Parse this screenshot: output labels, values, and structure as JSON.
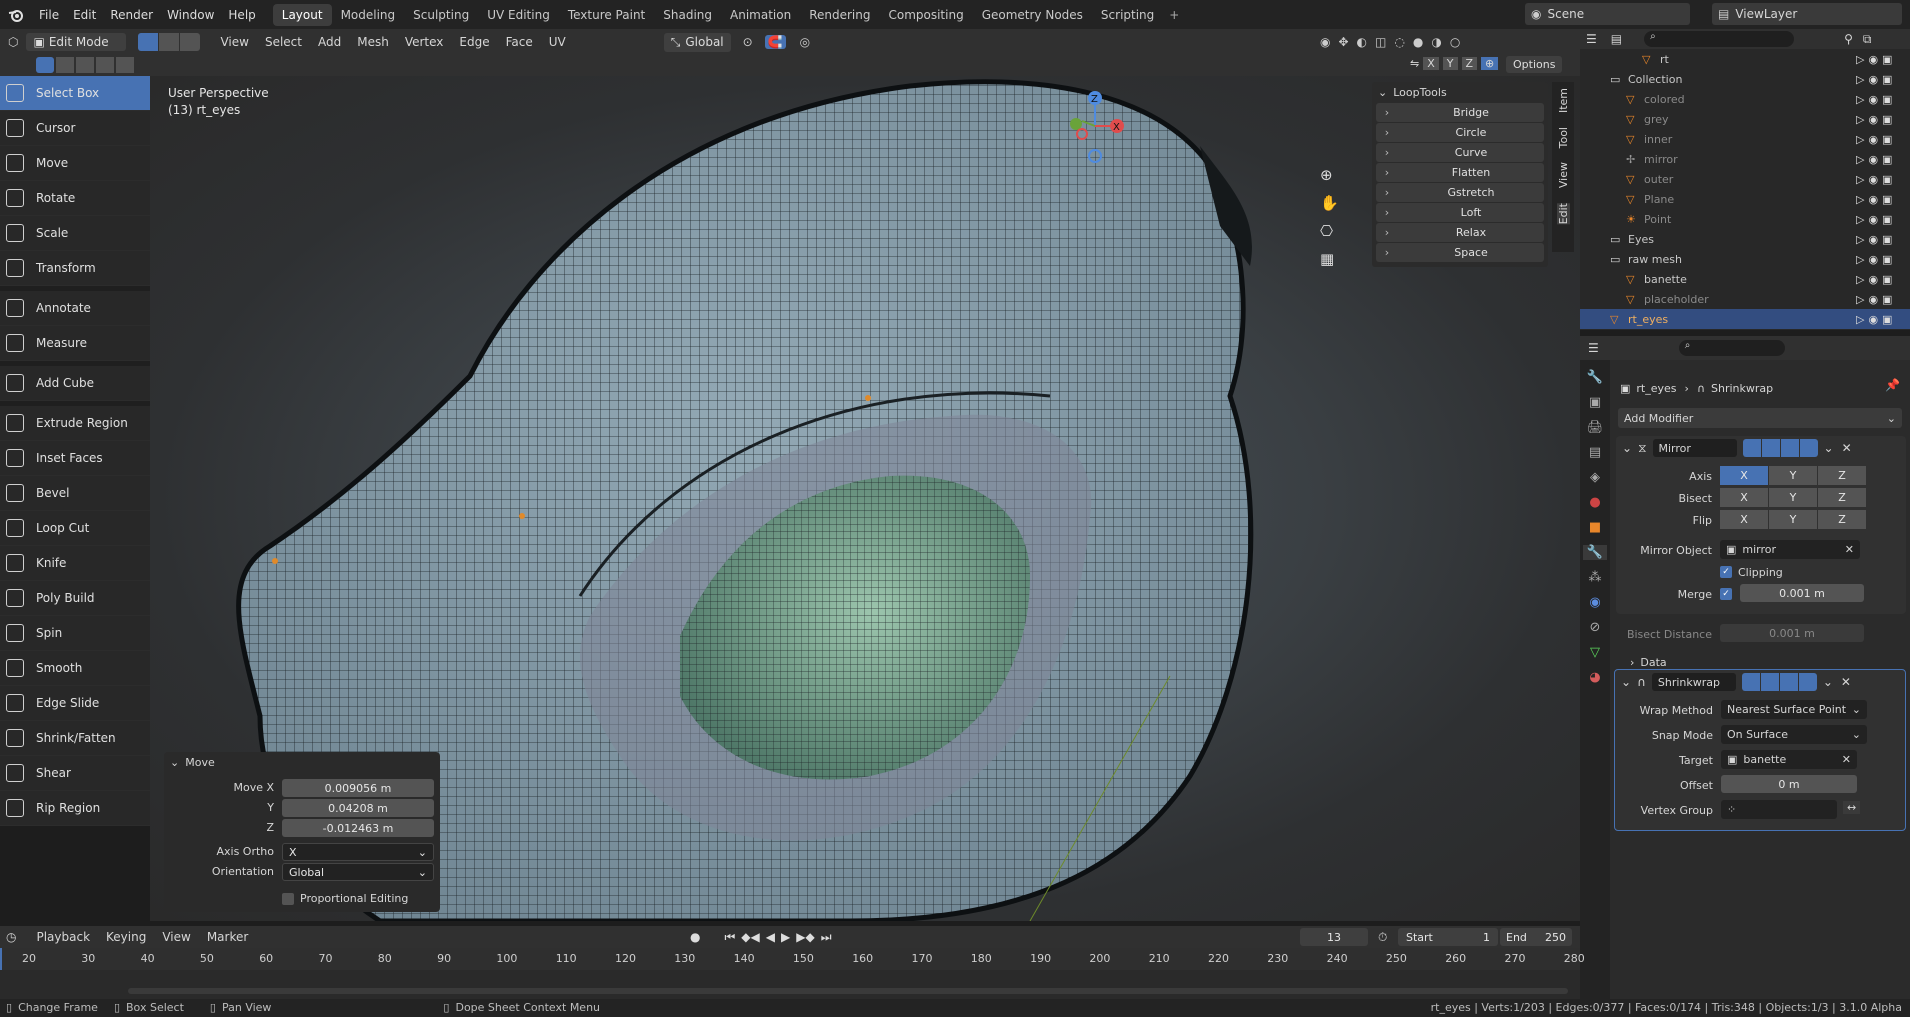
{
  "menu": [
    "File",
    "Edit",
    "Render",
    "Window",
    "Help"
  ],
  "workspaces": [
    "Layout",
    "Modeling",
    "Sculpting",
    "UV Editing",
    "Texture Paint",
    "Shading",
    "Animation",
    "Rendering",
    "Compositing",
    "Geometry Nodes",
    "Scripting"
  ],
  "scene": "Scene",
  "view_layer": "ViewLayer",
  "header": {
    "mode": "Edit Mode",
    "menus": [
      "View",
      "Select",
      "Add",
      "Mesh",
      "Vertex",
      "Edge",
      "Face",
      "UV"
    ],
    "transform_orientation": "Global",
    "axes": [
      "X",
      "Y",
      "Z"
    ],
    "options": "Options"
  },
  "tools": [
    "Select Box",
    "Cursor",
    "Move",
    "Rotate",
    "Scale",
    "Transform",
    "Annotate",
    "Measure",
    "Add Cube",
    "Extrude Region",
    "Inset Faces",
    "Bevel",
    "Loop Cut",
    "Knife",
    "Poly Build",
    "Spin",
    "Smooth",
    "Edge Slide",
    "Shrink/Fatten",
    "Shear",
    "Rip Region"
  ],
  "viewport": {
    "perspective": "User Perspective",
    "object": "(13) rt_eyes"
  },
  "looptools": {
    "title": "LoopTools",
    "items": [
      "Bridge",
      "Circle",
      "Curve",
      "Flatten",
      "Gstretch",
      "Loft",
      "Relax",
      "Space"
    ]
  },
  "side_tabs": [
    "Item",
    "Tool",
    "View",
    "Edit"
  ],
  "move_panel": {
    "title": "Move",
    "move_x_label": "Move X",
    "move_x": "0.009056 m",
    "y_label": "Y",
    "y": "0.04208 m",
    "z_label": "Z",
    "z": "-0.012463 m",
    "axis_ortho_label": "Axis Ortho",
    "axis_ortho": "X",
    "orientation_label": "Orientation",
    "orientation": "Global",
    "proportional": "Proportional Editing"
  },
  "outliner": [
    {
      "name": "rt",
      "indent": 3,
      "type": "mesh"
    },
    {
      "name": "Collection",
      "indent": 1,
      "type": "collection"
    },
    {
      "name": "colored",
      "indent": 2,
      "type": "mesh",
      "dim": true
    },
    {
      "name": "grey",
      "indent": 2,
      "type": "mesh",
      "dim": true
    },
    {
      "name": "inner",
      "indent": 2,
      "type": "mesh",
      "dim": true
    },
    {
      "name": "mirror",
      "indent": 2,
      "type": "empty",
      "dim": true
    },
    {
      "name": "outer",
      "indent": 2,
      "type": "mesh",
      "dim": true
    },
    {
      "name": "Plane",
      "indent": 2,
      "type": "mesh",
      "dim": true
    },
    {
      "name": "Point",
      "indent": 2,
      "type": "light",
      "dim": true
    },
    {
      "name": "Eyes",
      "indent": 1,
      "type": "collection"
    },
    {
      "name": "raw mesh",
      "indent": 1,
      "type": "collection"
    },
    {
      "name": "banette",
      "indent": 2,
      "type": "mesh"
    },
    {
      "name": "placeholder",
      "indent": 2,
      "type": "mesh",
      "dim": true
    },
    {
      "name": "rt_eyes",
      "indent": 1,
      "type": "mesh",
      "highlight": true
    }
  ],
  "properties": {
    "breadcrumb_object": "rt_eyes",
    "breadcrumb_modifier": "Shrinkwrap",
    "add_modifier": "Add Modifier",
    "mirror": {
      "name": "Mirror",
      "axis_label": "Axis",
      "bisect_label": "Bisect",
      "flip_label": "Flip",
      "axes": [
        "X",
        "Y",
        "Z"
      ],
      "mirror_object_label": "Mirror Object",
      "mirror_object": "mirror",
      "clipping": "Clipping",
      "merge_label": "Merge",
      "merge": "0.001 m",
      "bisect_distance_label": "Bisect Distance",
      "bisect_distance": "0.001 m",
      "data": "Data"
    },
    "shrinkwrap": {
      "name": "Shrinkwrap",
      "wrap_method_label": "Wrap Method",
      "wrap_method": "Nearest Surface Point",
      "snap_mode_label": "Snap Mode",
      "snap_mode": "On Surface",
      "target_label": "Target",
      "target": "banette",
      "offset_label": "Offset",
      "offset": "0 m",
      "vertex_group_label": "Vertex Group"
    }
  },
  "timeline": {
    "menus": [
      "Playback",
      "Keying",
      "View",
      "Marker"
    ],
    "current_frame": "13",
    "start_label": "Start",
    "start": "1",
    "end_label": "End",
    "end": "250",
    "ticks": [
      "20",
      "30",
      "40",
      "50",
      "60",
      "70",
      "80",
      "90",
      "100",
      "110",
      "120",
      "130",
      "140",
      "150",
      "160",
      "170",
      "180",
      "190",
      "200",
      "210",
      "220",
      "230",
      "240",
      "250",
      "260",
      "270",
      "280"
    ]
  },
  "status": {
    "change_frame": "Change Frame",
    "box_select": "Box Select",
    "pan_view": "Pan View",
    "context_menu": "Dope Sheet Context Menu",
    "stats": "rt_eyes | Verts:1/203 | Edges:0/377 | Faces:0/174 | Tris:348 | Objects:1/3 | 3.1.0 Alpha"
  },
  "colors": {
    "accent": "#4772b3",
    "mesh": "#8fa7b1",
    "eye": "#7aa890"
  }
}
